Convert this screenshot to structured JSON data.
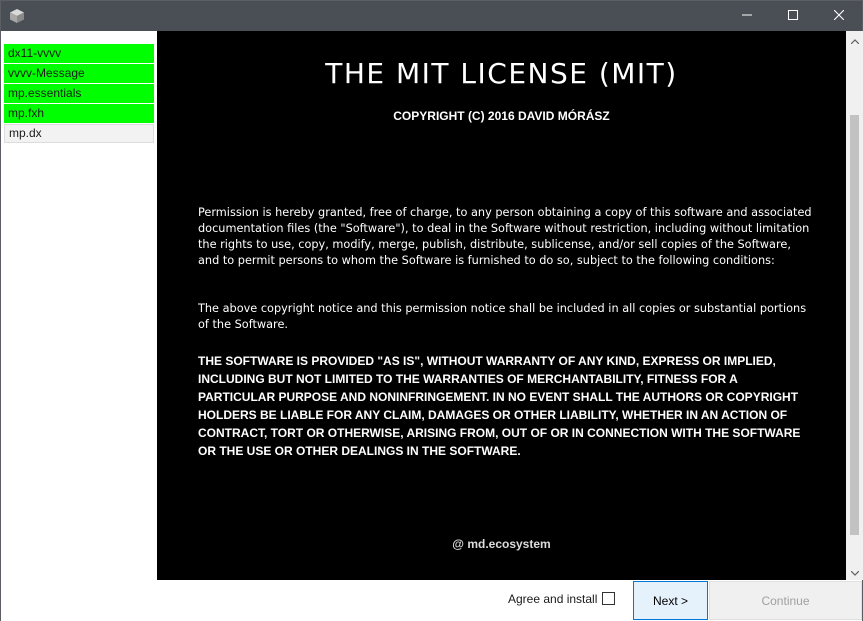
{
  "window": {
    "icon": "cube-icon",
    "controls": [
      "minimize-icon",
      "maximize-icon",
      "close-icon"
    ]
  },
  "sidebar": {
    "items": [
      {
        "label": "dx11-vvvv",
        "status": "ok"
      },
      {
        "label": "vvvv-Message",
        "status": "ok"
      },
      {
        "label": "mp.essentials",
        "status": "ok"
      },
      {
        "label": "mp.fxh",
        "status": "ok"
      },
      {
        "label": "mp.dx",
        "status": "pending"
      }
    ],
    "colors": {
      "ok": "#00ff00",
      "pending": "#f2f2f2"
    }
  },
  "license": {
    "title": "THE MIT LICENSE (MIT)",
    "copyright": "COPYRIGHT (C) 2016 DAVID MÓRÁSZ",
    "paragraph1": "Permission is hereby granted, free of charge, to any person obtaining a copy of this software and associated documentation files (the \"Software\"), to deal in the Software without restriction, including without limitation the rights to use, copy, modify, merge, publish, distribute, sublicense, and/or sell copies of the Software, and to permit persons to whom the Software is furnished to do so, subject to the following conditions:",
    "paragraph2": "The above copyright notice and this permission notice shall be included in all copies or substantial portions of the Software.",
    "warranty": "THE SOFTWARE IS PROVIDED \"AS IS\", WITHOUT WARRANTY OF ANY KIND, EXPRESS OR IMPLIED, INCLUDING BUT NOT LIMITED TO THE WARRANTIES OF MERCHANTABILITY, FITNESS FOR A PARTICULAR PURPOSE AND NONINFRINGEMENT. IN NO EVENT SHALL THE AUTHORS OR COPYRIGHT HOLDERS BE LIABLE FOR ANY CLAIM, DAMAGES OR OTHER LIABILITY, WHETHER IN AN ACTION OF CONTRACT, TORT OR OTHERWISE, ARISING FROM, OUT OF OR IN CONNECTION WITH THE SOFTWARE OR THE USE OR OTHER DEALINGS IN THE SOFTWARE.",
    "footer": "@ md.ecosystem"
  },
  "footer": {
    "agree_label": "Agree and install",
    "agree_checked": false,
    "next_label": "Next >",
    "continue_label": "Continue"
  },
  "colors": {
    "titlebar": "#4a4f55",
    "content_bg": "#000000",
    "accent": "#0078d7"
  }
}
